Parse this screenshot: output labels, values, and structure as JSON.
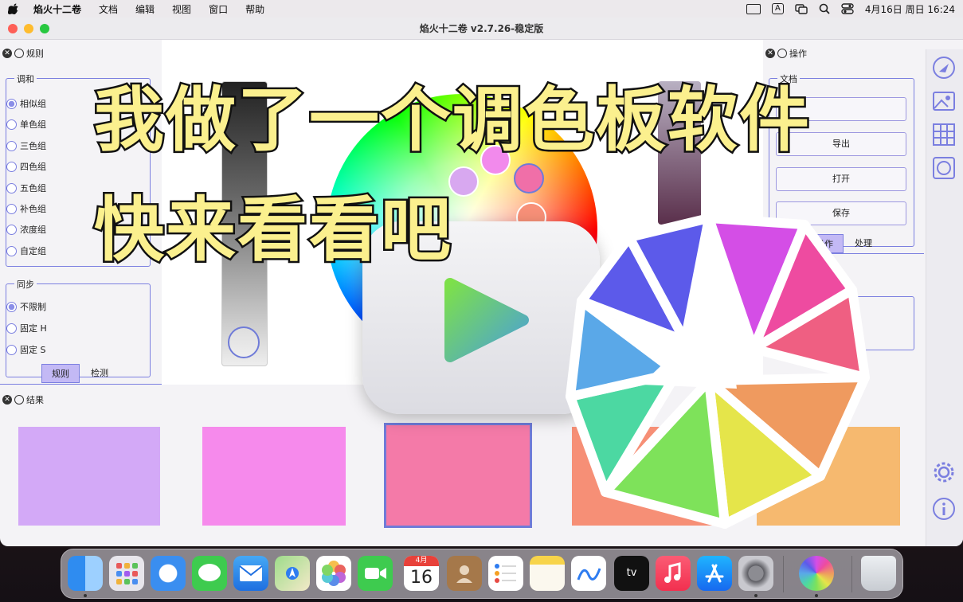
{
  "menubar": {
    "app_name": "焰火十二卷",
    "menus": [
      "文档",
      "编辑",
      "视图",
      "窗口",
      "帮助"
    ],
    "input_source": "A",
    "datetime": "4月16日 周日  16:24"
  },
  "window": {
    "title": "焰火十二卷 v2.7.26-稳定版"
  },
  "rules_panel": {
    "title": "规则",
    "harmony_group": {
      "title": "调和",
      "options": [
        "相似组",
        "单色组",
        "三色组",
        "四色组",
        "五色组",
        "补色组",
        "浓度组",
        "自定组"
      ],
      "selected": "相似组"
    },
    "sync_group": {
      "title": "同步",
      "options": [
        "不限制",
        "固定 H",
        "固定 S"
      ],
      "selected": "不限制"
    },
    "tabs": [
      "规则",
      "检测"
    ],
    "active_tab": "规则"
  },
  "ops_panel": {
    "title": "操作",
    "doc_label": "文档",
    "buttons": [
      "",
      "导出",
      "打开",
      "保存"
    ],
    "tabs": [
      "操作",
      "处理"
    ],
    "active_tab": "操作"
  },
  "results_panel": {
    "title": "结果",
    "swatches": [
      "#d3a9f7",
      "#f68aec",
      "#f47aa8",
      "#f68f76",
      "#f6b96f"
    ],
    "selected_index": 2
  },
  "overlay": {
    "line1": "我做了一个调色板软件",
    "line2": "快来看看吧"
  },
  "colors": {
    "accent": "#7b7fe0",
    "tab_active": "#c3b9f5",
    "title_fill": "#fbf08e"
  },
  "dock": {
    "icons": [
      "finder-icon",
      "launchpad-icon",
      "safari-icon",
      "messages-icon",
      "mail-icon",
      "maps-icon",
      "photos-icon",
      "facetime-icon",
      "calendar-icon",
      "contacts-icon",
      "reminders-icon",
      "notes-icon",
      "freeform-icon",
      "tv-icon",
      "music-icon",
      "app-store-icon",
      "system-settings-icon",
      "palette-app-icon",
      "trash-icon"
    ],
    "calendar_month": "4月",
    "calendar_day": "16",
    "tv_label": "tv"
  }
}
